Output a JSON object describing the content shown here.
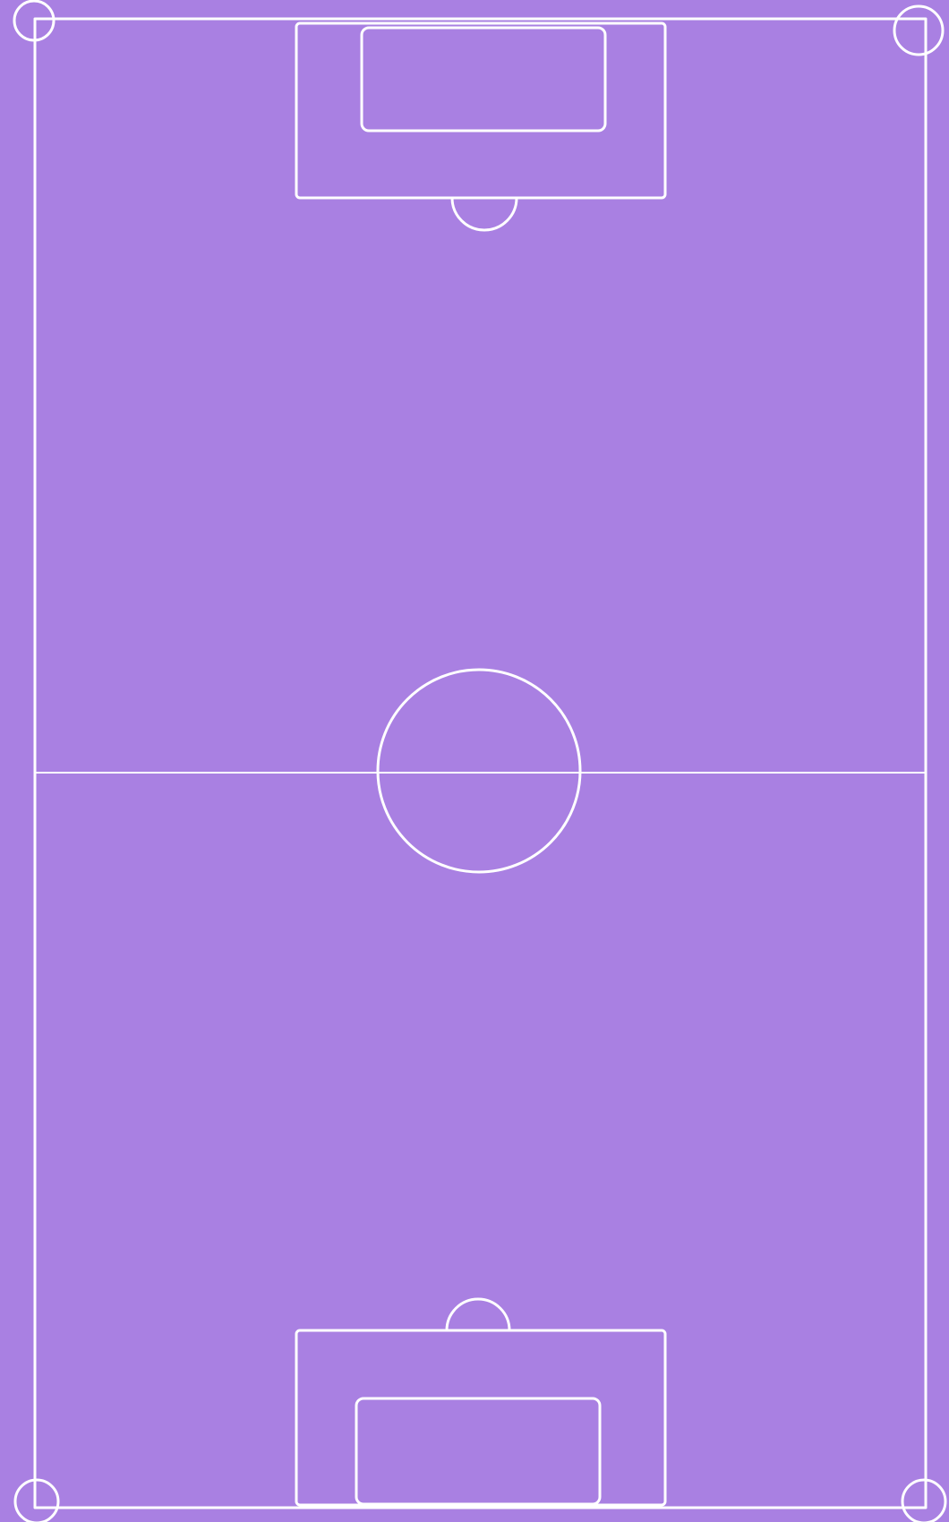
{
  "pitch": {
    "background_color": "#a980e2",
    "line_color": "#ffffff"
  }
}
